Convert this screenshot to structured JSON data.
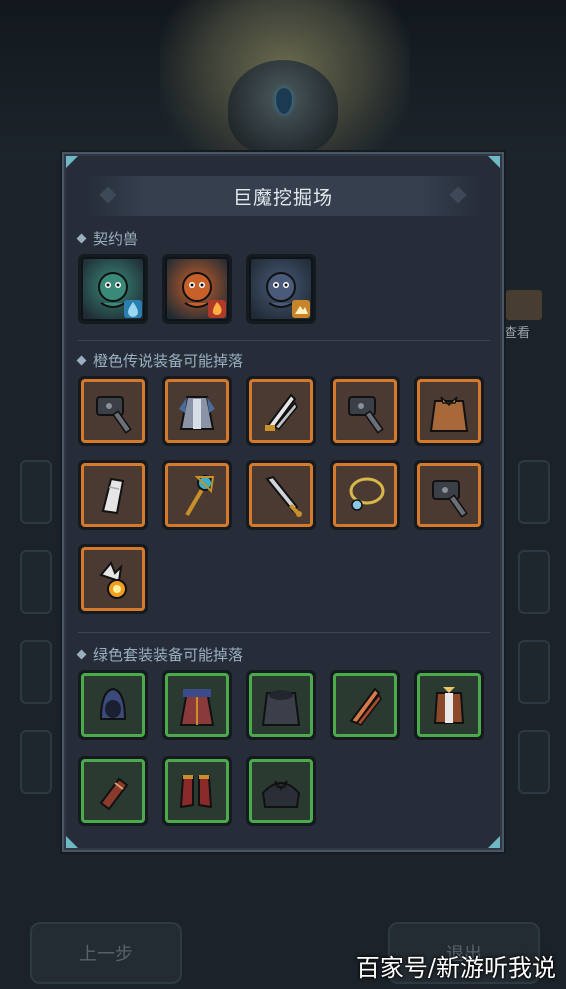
{
  "dialog": {
    "title": "巨魔挖掘场"
  },
  "sections": {
    "pets_label": "契约兽",
    "orange_label": "橙色传说装备可能掉落",
    "green_label": "绿色套装装备可能掉落"
  },
  "pets": [
    {
      "name": "green-sprite-pet",
      "element": "water-icon",
      "element_color": "#2a7fb0",
      "bg": "#3a8a7a"
    },
    {
      "name": "fire-lion-pet",
      "element": "fire-icon",
      "element_color": "#b03a2a",
      "bg": "#c8602a"
    },
    {
      "name": "purple-cat-pet",
      "element": "earth-icon",
      "element_color": "#c8842a",
      "bg": "#4a5a7a"
    }
  ],
  "orange_items": [
    "hammer-icon",
    "robe-icon",
    "blade-icon",
    "hammer-icon",
    "cloak-icon",
    "scroll-icon",
    "staff-icon",
    "sword-icon",
    "necklace-icon",
    "hammer-icon",
    "fire-rune-icon"
  ],
  "green_items": [
    "hood-icon",
    "red-robe-icon",
    "dark-cloak-icon",
    "feather-blade-icon",
    "armor-icon",
    "bracer-icon",
    "boots-icon",
    "shoulder-icon"
  ],
  "background": {
    "side_label": "查看",
    "prev_button": "上一步",
    "exit_button": "退出"
  },
  "watermark": "百家号/新游听我说",
  "colors": {
    "orange_frame": "#d47a2a",
    "green_frame": "#4caa4c",
    "dialog_bg": "#262d38",
    "corner_accent": "#6fb8c6"
  }
}
